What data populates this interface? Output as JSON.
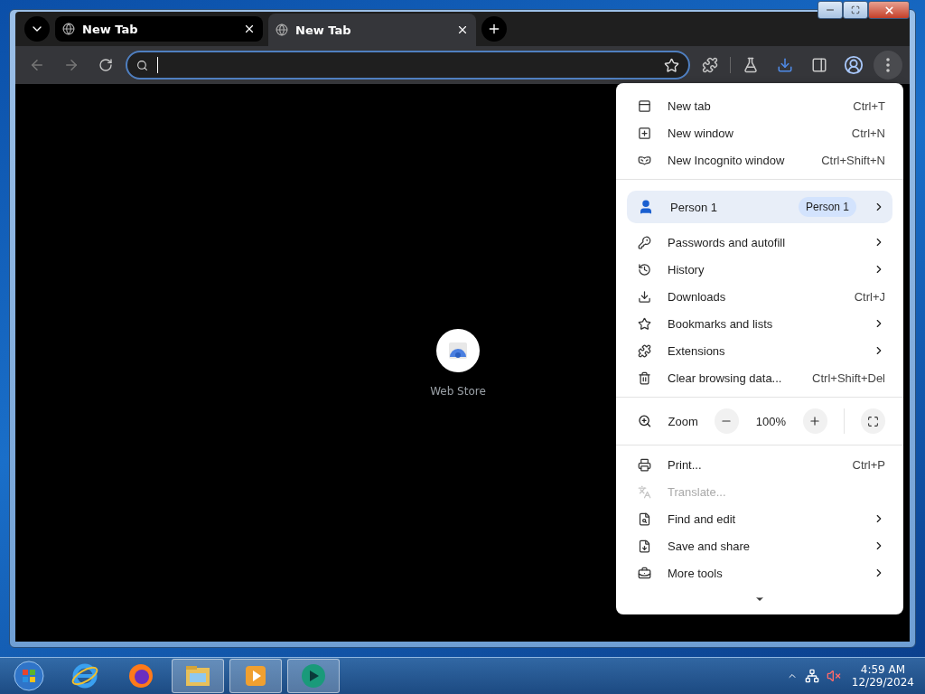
{
  "tabs": [
    {
      "title": "New Tab",
      "selected": false
    },
    {
      "title": "New Tab",
      "selected": true
    }
  ],
  "shortcut": {
    "label": "Web Store"
  },
  "menu": {
    "sections": [
      {
        "items": [
          {
            "kind": "item",
            "label": "New tab",
            "shortcut": "Ctrl+T",
            "submenu": false,
            "disabled": false
          },
          {
            "kind": "item",
            "label": "New window",
            "shortcut": "Ctrl+N",
            "submenu": false,
            "disabled": false
          },
          {
            "kind": "item",
            "label": "New Incognito window",
            "shortcut": "Ctrl+Shift+N",
            "submenu": false,
            "disabled": false
          }
        ]
      },
      {
        "items": [
          {
            "kind": "person",
            "label": "Person 1",
            "badge": "Person 1",
            "submenu": true
          },
          {
            "kind": "item",
            "label": "Passwords and autofill",
            "submenu": true,
            "disabled": false
          },
          {
            "kind": "item",
            "label": "History",
            "submenu": true,
            "disabled": false
          },
          {
            "kind": "item",
            "label": "Downloads",
            "shortcut": "Ctrl+J",
            "submenu": false,
            "disabled": false
          },
          {
            "kind": "item",
            "label": "Bookmarks and lists",
            "submenu": true,
            "disabled": false
          },
          {
            "kind": "item",
            "label": "Extensions",
            "submenu": true,
            "disabled": false
          },
          {
            "kind": "item",
            "label": "Clear browsing data...",
            "shortcut": "Ctrl+Shift+Del",
            "submenu": false,
            "disabled": false
          }
        ]
      },
      {
        "items": [
          {
            "kind": "zoom",
            "label": "Zoom",
            "value": "100%"
          }
        ]
      },
      {
        "items": [
          {
            "kind": "item",
            "label": "Print...",
            "shortcut": "Ctrl+P",
            "submenu": false,
            "disabled": false
          },
          {
            "kind": "item",
            "label": "Translate...",
            "submenu": false,
            "disabled": true
          },
          {
            "kind": "item",
            "label": "Find and edit",
            "submenu": true,
            "disabled": false
          },
          {
            "kind": "item",
            "label": "Save and share",
            "submenu": true,
            "disabled": false
          },
          {
            "kind": "item",
            "label": "More tools",
            "submenu": true,
            "disabled": false
          }
        ]
      }
    ]
  },
  "taskbar": {
    "time": "4:59 AM",
    "date": "12/29/2024"
  }
}
